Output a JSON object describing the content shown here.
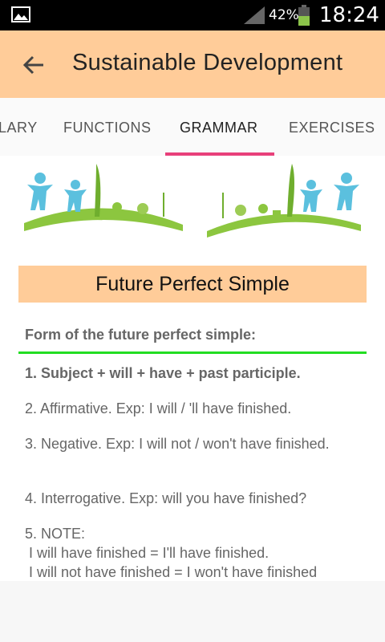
{
  "status_bar": {
    "battery_percent": "42%",
    "time": "18:24",
    "icons": [
      "image-icon",
      "signal-icon",
      "battery-icon"
    ]
  },
  "app_bar": {
    "title": "Sustainable Development",
    "back_icon": "back-arrow-icon"
  },
  "tabs": [
    {
      "label": "LARY"
    },
    {
      "label": "FUNCTIONS"
    },
    {
      "label": "GRAMMAR",
      "active": true
    },
    {
      "label": "EXERCISES"
    }
  ],
  "content": {
    "heading": "Future Perfect Simple",
    "form_label": "Form of the future perfect simple:",
    "items": [
      "1. Subject + will + have + past participle.",
      "2. Affirmative.  Exp: I will / 'll have finished.",
      "3. Negative.  Exp:  I will not / won't have finished.",
      "4. Interrogative.  Exp: will you have finished?"
    ],
    "note": {
      "label": "5. NOTE:",
      "line1": " I will have finished = I'll have finished.",
      "line2": " I will not have finished = I won't have finished"
    }
  },
  "colors": {
    "app_bar": "#ffcc99",
    "tab_indicator": "#e8407a",
    "divider": "#22dd22"
  }
}
